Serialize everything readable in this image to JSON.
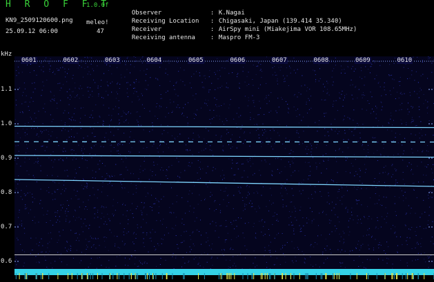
{
  "header": {
    "app_title": "H R O F F T",
    "version": "1.0.0f",
    "filename": "KN9_2509120600.png",
    "meleo_label": "meleo!",
    "meleo_value": "47",
    "timestamp": "25.09.12 06:00"
  },
  "info": [
    {
      "key": "Observer",
      "value": "K.Nagai"
    },
    {
      "key": "Receiving Location",
      "value": "Chigasaki, Japan (139.414 35.340)"
    },
    {
      "key": "Receiver",
      "value": "AirSpy mini (Miakejima VOR 108.65MHz)"
    },
    {
      "key": "Receiving antenna",
      "value": "Maspro FM-3"
    }
  ],
  "colors": {
    "background": "#000000",
    "plot_background": "#05051e",
    "signal": "#7fd6ff",
    "header_green": "#39d239",
    "time_bar": "#34d2e6"
  },
  "chart_data": {
    "type": "heatmap",
    "y_unit": "kHz",
    "y_ticks": [
      "1.1",
      "1.0",
      "0.9",
      "0.8",
      "0.7",
      "0.6"
    ],
    "y_range": [
      0.6,
      1.15
    ],
    "x_ticks": [
      "0601",
      "0602",
      "0603",
      "0604",
      "0605",
      "0606",
      "0607",
      "0608",
      "0609",
      "0610"
    ],
    "x_range_minutes": [
      0,
      10
    ],
    "traces": [
      {
        "freq_start": 0.993,
        "freq_end": 0.989,
        "style": "solid"
      },
      {
        "freq_start": 0.948,
        "freq_end": 0.947,
        "style": "dashed"
      },
      {
        "freq_start": 0.908,
        "freq_end": 0.903,
        "style": "solid"
      },
      {
        "freq_start": 0.838,
        "freq_end": 0.818,
        "style": "solid"
      }
    ],
    "reference_line_freq": 0.619
  }
}
